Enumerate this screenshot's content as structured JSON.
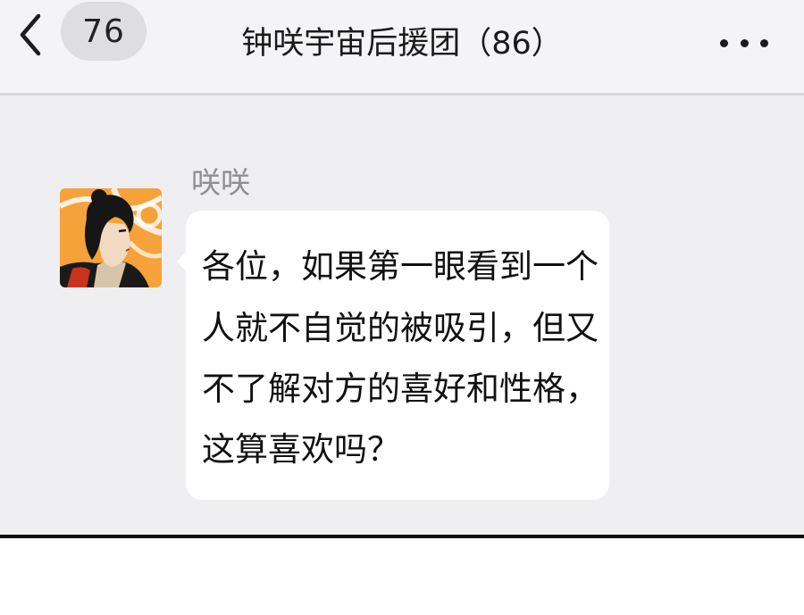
{
  "header": {
    "unread_count": "76",
    "title": "钟咲宇宙后援团（86）"
  },
  "message": {
    "sender": "咲咲",
    "lines": [
      "各位，如果第一眼看到一个",
      "人就不自觉的被吸引，但又",
      "不了解对方的喜好和性格，",
      "这算喜欢吗？"
    ]
  },
  "icons": {
    "back": "chevron-left-icon",
    "more": "more-dots-icon",
    "avatar": "avatar-illustration"
  },
  "colors": {
    "screen_bg": "#efeff1",
    "bubble_bg": "#ffffff",
    "badge_bg": "#dedee1",
    "sender_name": "#8e8e93",
    "avatar_accent": "#f5a23a"
  }
}
